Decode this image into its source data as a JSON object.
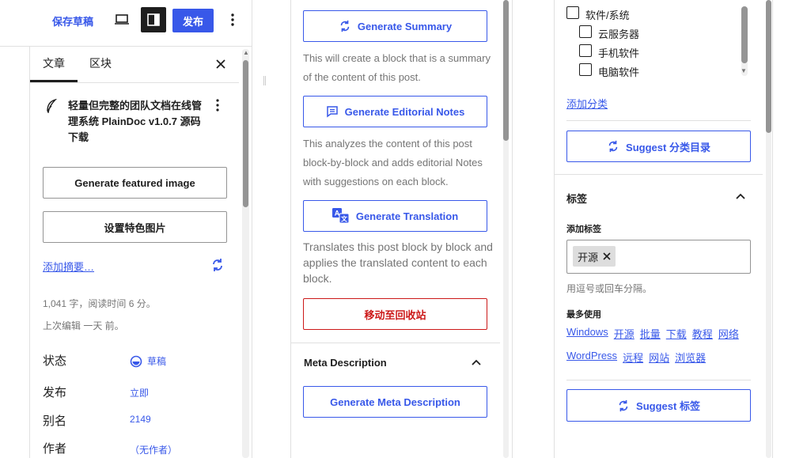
{
  "toolbar": {
    "save_draft": "保存草稿",
    "publish": "发布",
    "more_icon": "more-vertical-icon",
    "preview_icon": "desktop-icon",
    "settings_icon": "sidebar-icon"
  },
  "sidebar": {
    "tabs": [
      {
        "label": "文章",
        "active": true
      },
      {
        "label": "区块",
        "active": false
      }
    ],
    "close_icon": "close-icon",
    "post_title": "轻量但完整的团队文档在线管理系统 PlainDoc v1.0.7 源码下载",
    "generate_featured_image": "Generate featured image",
    "set_featured_image": "设置特色图片",
    "add_excerpt": "添加摘要…",
    "word_count": "1,041 字，阅读时间 6 分。",
    "last_edited": "上次编辑 一天 前。",
    "rows": [
      {
        "label": "状态",
        "value": "草稿"
      },
      {
        "label": "发布",
        "value": "立即"
      },
      {
        "label": "别名",
        "value": "2149"
      },
      {
        "label": "作者",
        "value": "（无作者）"
      }
    ]
  },
  "ai_panel": {
    "generate_summary": "Generate Summary",
    "summary_desc": "This will create a block that is a summary of the content of this post.",
    "generate_editorial_notes": "Generate Editorial Notes",
    "editorial_desc": "This analyzes the content of this post block-by-block and adds editorial Notes with suggestions on each block.",
    "generate_translation": "Generate Translation",
    "translation_desc": "Translates this post block by block and applies the translated content to each block.",
    "move_to_trash": "移动至回收站",
    "meta_section_title": "Meta Description",
    "generate_meta_description": "Generate Meta Description"
  },
  "taxonomy": {
    "categories": [
      {
        "label": "软件/系统",
        "level": 0
      },
      {
        "label": "云服务器",
        "level": 1
      },
      {
        "label": "手机软件",
        "level": 1
      },
      {
        "label": "电脑软件",
        "level": 1
      }
    ],
    "add_category": "添加分类",
    "suggest_categories": "Suggest 分类目录",
    "tags_section_title": "标签",
    "add_tag_label": "添加标签",
    "tags": [
      "开源"
    ],
    "tag_hint": "用逗号或回车分隔。",
    "most_used_label": "最多使用",
    "most_used_row1": [
      "Windows",
      "开源",
      "批量",
      "下载",
      "教程",
      "网络"
    ],
    "most_used_row2": [
      "WordPress",
      "远程",
      "网站",
      "浏览器"
    ],
    "suggest_tags": "Suggest 标签"
  },
  "colors": {
    "accent": "#3858e9",
    "danger": "#cc1818",
    "text": "#1e1e1e",
    "muted": "#757575",
    "border": "#e0e0e0"
  }
}
